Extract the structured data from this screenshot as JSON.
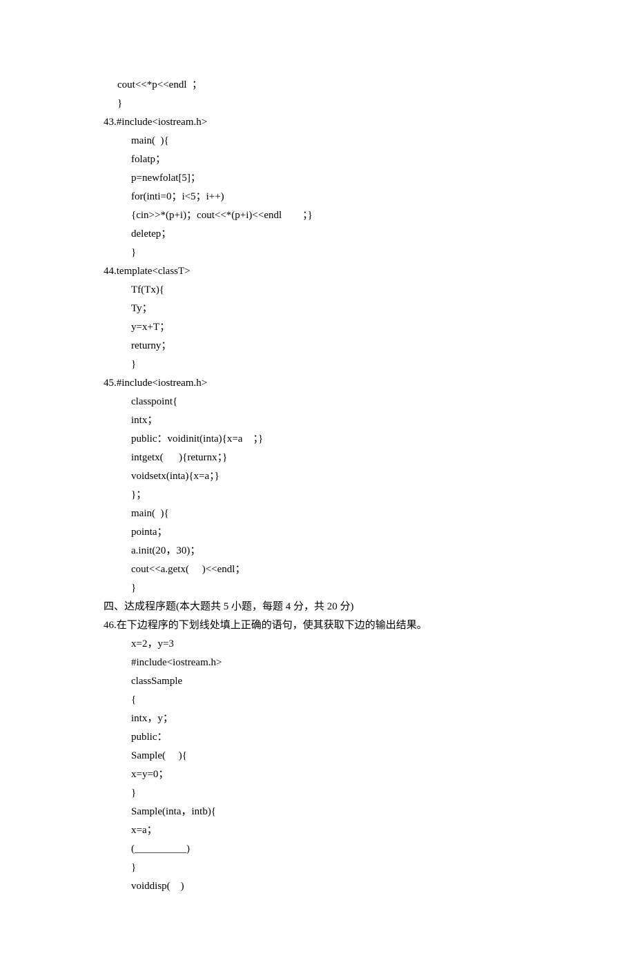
{
  "lines": [
    {
      "cls": "indent1a",
      "text": "cout<<*p<<endl  ；"
    },
    {
      "cls": "indent1a",
      "text": "}"
    },
    {
      "cls": "indent1",
      "text": "43.#include<iostream.h>"
    },
    {
      "cls": "indent2",
      "text": "main(  ){"
    },
    {
      "cls": "indent2",
      "text": "folatp；"
    },
    {
      "cls": "indent2",
      "text": "p=newfolat[5]；"
    },
    {
      "cls": "indent2",
      "text": "for(inti=0；i<5；i++)"
    },
    {
      "cls": "indent2",
      "text": "{cin>>*(p+i)；cout<<*(p+i)<<endl        ；}"
    },
    {
      "cls": "indent2",
      "text": "deletep；"
    },
    {
      "cls": "indent2",
      "text": "}"
    },
    {
      "cls": "indent1",
      "text": "44.template<classT>"
    },
    {
      "cls": "indent2",
      "text": "Tf(Tx){"
    },
    {
      "cls": "indent2",
      "text": "Ty；"
    },
    {
      "cls": "indent2",
      "text": "y=x+T；"
    },
    {
      "cls": "indent2",
      "text": "returny；"
    },
    {
      "cls": "indent2",
      "text": "}"
    },
    {
      "cls": "indent1",
      "text": "45.#include<iostream.h>"
    },
    {
      "cls": "indent2",
      "text": "classpoint{"
    },
    {
      "cls": "indent2",
      "text": "intx；"
    },
    {
      "cls": "indent2",
      "text": "public：voidinit(inta){x=a    ；}"
    },
    {
      "cls": "indent2",
      "text": "intgetx(      ){returnx；}"
    },
    {
      "cls": "indent2",
      "text": "voidsetx(inta){x=a；}"
    },
    {
      "cls": "indent2",
      "text": "}；"
    },
    {
      "cls": "indent2",
      "text": "main(  ){"
    },
    {
      "cls": "indent2",
      "text": "pointa；"
    },
    {
      "cls": "indent2",
      "text": "a.init(20，30)；"
    },
    {
      "cls": "indent2",
      "text": "cout<<a.getx(     )<<endl；"
    },
    {
      "cls": "indent2",
      "text": "}"
    },
    {
      "cls": "indent1",
      "text": "四、达成程序题(本大题共 5 小题，每题 4 分，共 20 分)"
    },
    {
      "cls": "indent1",
      "text": "46.在下边程序的下划线处填上正确的语句，使其获取下边的输出结果。"
    },
    {
      "cls": "indent2",
      "text": "x=2，y=3"
    },
    {
      "cls": "indent2",
      "text": "#include<iostream.h>"
    },
    {
      "cls": "indent2",
      "text": "classSample"
    },
    {
      "cls": "indent2",
      "text": "{"
    },
    {
      "cls": "indent2",
      "text": "intx，y；"
    },
    {
      "cls": "indent2",
      "text": "public："
    },
    {
      "cls": "indent2",
      "text": "Sample(     ){"
    },
    {
      "cls": "indent2",
      "text": "x=y=0；"
    },
    {
      "cls": "indent2",
      "text": "}"
    },
    {
      "cls": "indent2",
      "text": "Sample(inta，intb){"
    },
    {
      "cls": "indent2",
      "text": "x=a；"
    },
    {
      "cls": "indent2",
      "text": "(__________)"
    },
    {
      "cls": "indent2",
      "text": "}"
    },
    {
      "cls": "indent2",
      "text": "voiddisp(    )"
    }
  ]
}
